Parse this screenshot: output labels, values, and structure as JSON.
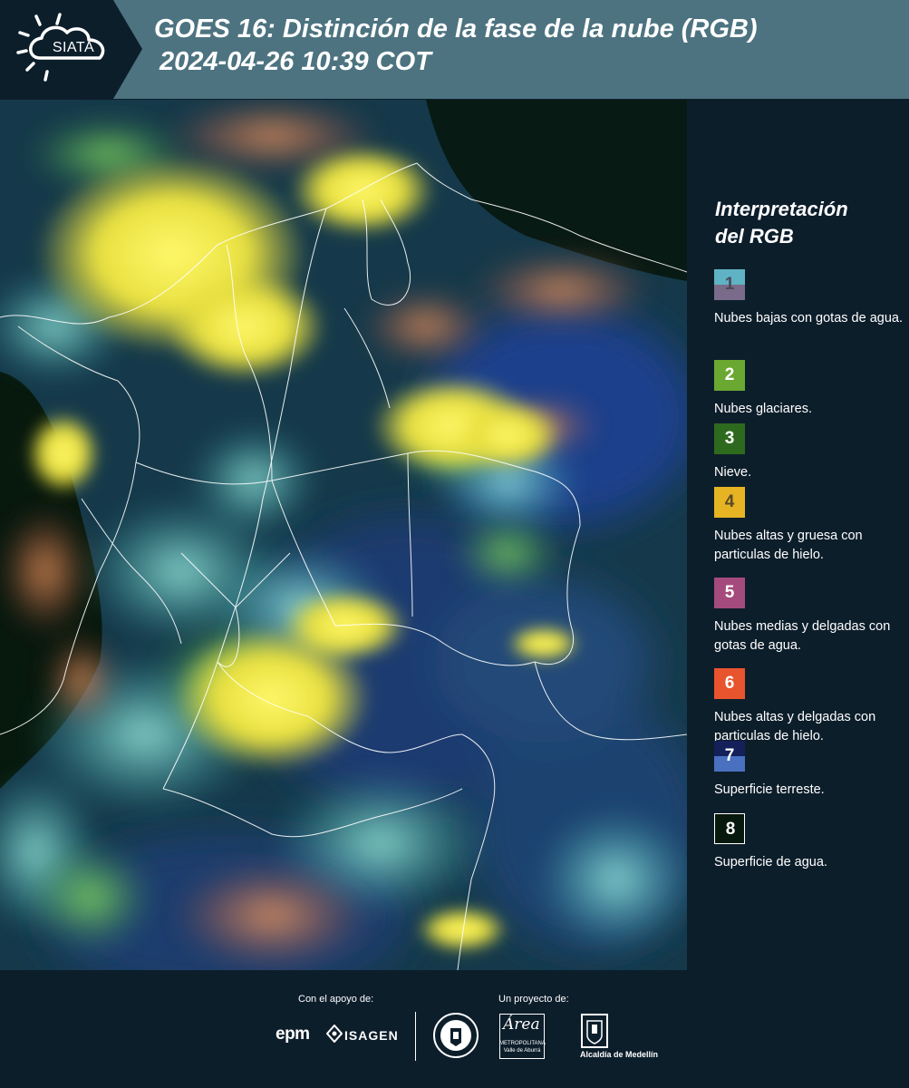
{
  "header": {
    "logo_text": "SIATA",
    "title_line1": "GOES 16: Distinción de la fase de la nube (RGB)",
    "title_line2": "2024-04-26 10:39 COT"
  },
  "legend": {
    "title_line1": "Interpretación",
    "title_line2": "del RGB",
    "items": [
      {
        "number": "1",
        "label": "Nubes bajas con gotas de agua.",
        "color_top": "#5fb3c4",
        "color_bottom": "#7a6b8a",
        "text_color": "#4a4a5a"
      },
      {
        "number": "2",
        "label": "Nubes glaciares.",
        "color_top": "#6aa832",
        "color_bottom": "#6aa832",
        "text_color": "#ffffff"
      },
      {
        "number": "3",
        "label": "Nieve.",
        "color_top": "#2e6a1e",
        "color_bottom": "#2e6a1e",
        "text_color": "#ffffff"
      },
      {
        "number": "4",
        "label": "Nubes altas y gruesa con particulas de hielo.",
        "color_top": "#e6b422",
        "color_bottom": "#e6b422",
        "text_color": "#5a4a2a"
      },
      {
        "number": "5",
        "label": "Nubes medias y delgadas con gotas de agua.",
        "color_top": "#a54a7c",
        "color_bottom": "#a54a7c",
        "text_color": "#ffffff"
      },
      {
        "number": "6",
        "label": "Nubes altas y delgadas con particulas de hielo.",
        "color_top": "#e8542e",
        "color_bottom": "#e8542e",
        "text_color": "#ffffff"
      },
      {
        "number": "7",
        "label": "Superficie terreste.",
        "color_top": "#14205a",
        "color_bottom": "#4a70c0",
        "text_color": "#ffffff"
      },
      {
        "number": "8",
        "label": "Superficie de agua.",
        "color_top": "#07180d",
        "color_bottom": "#07180d",
        "text_color": "#ffffff"
      }
    ]
  },
  "footer": {
    "support_label": "Con el apoyo de:",
    "project_label": "Un proyecto de:",
    "sponsor1": "epm",
    "sponsor2": "ISAGEN",
    "amva_script": "Área",
    "amva_line1": "METROPOLITANA",
    "amva_line2": "Valle de Aburrá",
    "alcaldia": "Alcaldía de Medellín"
  },
  "colors": {
    "header_bg": "#4d7380",
    "page_bg": "#0d1e2b",
    "border_lines": "#ffffff"
  }
}
